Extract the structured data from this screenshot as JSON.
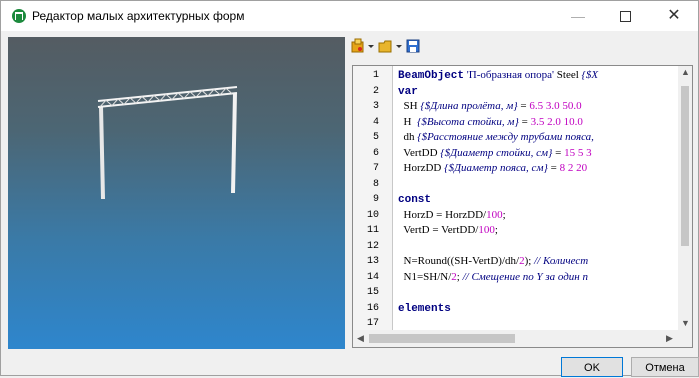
{
  "window": {
    "title": "Редактор малых архитектурных форм",
    "minimize_symbol": "—",
    "close_symbol": "✕",
    "icon": "app-logo-icon"
  },
  "toolbar": {
    "items": [
      {
        "name": "insert-template-icon",
        "has_dropdown": true
      },
      {
        "name": "open-folder-icon",
        "has_dropdown": true
      },
      {
        "name": "save-floppy-icon",
        "has_dropdown": false
      }
    ]
  },
  "editor": {
    "lines": [
      {
        "n": "1",
        "parts": [
          [
            "kw",
            "BeamObject"
          ],
          [
            "id",
            " "
          ],
          [
            "str",
            "'П-образная опора'"
          ],
          [
            "id",
            " Steel "
          ],
          [
            "cm",
            "{$X"
          ]
        ]
      },
      {
        "n": "2",
        "parts": [
          [
            "kw",
            "var"
          ]
        ]
      },
      {
        "n": "3",
        "parts": [
          [
            "id",
            "  SH "
          ],
          [
            "cm",
            "{$Длина пролёта, м}"
          ],
          [
            "id",
            " = "
          ],
          [
            "num",
            "6.5 3.0 50.0"
          ]
        ]
      },
      {
        "n": "4",
        "parts": [
          [
            "id",
            "  H  "
          ],
          [
            "cm",
            "{$Высота стойки, м}"
          ],
          [
            "id",
            " = "
          ],
          [
            "num",
            "3.5 2.0 10.0"
          ]
        ]
      },
      {
        "n": "5",
        "parts": [
          [
            "id",
            "  dh "
          ],
          [
            "cm",
            "{$Расстояние между трубами пояса, "
          ]
        ]
      },
      {
        "n": "6",
        "parts": [
          [
            "id",
            "  VertDD "
          ],
          [
            "cm",
            "{$Диаметр стойки, см}"
          ],
          [
            "id",
            " = "
          ],
          [
            "num",
            "15 5 3"
          ]
        ]
      },
      {
        "n": "7",
        "parts": [
          [
            "id",
            "  HorzDD "
          ],
          [
            "cm",
            "{$Диаметр пояса, см}"
          ],
          [
            "id",
            " = "
          ],
          [
            "num",
            "8 2 20"
          ]
        ]
      },
      {
        "n": "8",
        "parts": []
      },
      {
        "n": "9",
        "parts": [
          [
            "kw",
            "const"
          ]
        ]
      },
      {
        "n": "10",
        "parts": [
          [
            "id",
            "  HorzD = HorzDD/"
          ],
          [
            "num",
            "100"
          ],
          [
            "id",
            ";"
          ]
        ]
      },
      {
        "n": "11",
        "parts": [
          [
            "id",
            "  VertD = VertDD/"
          ],
          [
            "num",
            "100"
          ],
          [
            "id",
            ";"
          ]
        ]
      },
      {
        "n": "12",
        "parts": []
      },
      {
        "n": "13",
        "parts": [
          [
            "id",
            "  N=Round((SH-VertD)/dh/"
          ],
          [
            "num",
            "2"
          ],
          [
            "id",
            "); "
          ],
          [
            "cm",
            "// Количест"
          ]
        ]
      },
      {
        "n": "14",
        "parts": [
          [
            "id",
            "  N1=SH/N/"
          ],
          [
            "num",
            "2"
          ],
          [
            "id",
            "; "
          ],
          [
            "cm",
            "// Смещение по Y за один п"
          ]
        ]
      },
      {
        "n": "15",
        "parts": []
      },
      {
        "n": "16",
        "parts": [
          [
            "kw",
            "elements"
          ]
        ]
      },
      {
        "n": "17",
        "parts": []
      }
    ]
  },
  "buttons": {
    "ok": "OK",
    "cancel": "Отмена"
  },
  "colors": {
    "keyword": "#000080",
    "number": "#c000c0",
    "comment": "#000080",
    "viewport_top": "#545c62",
    "viewport_bottom": "#2e86cd"
  }
}
